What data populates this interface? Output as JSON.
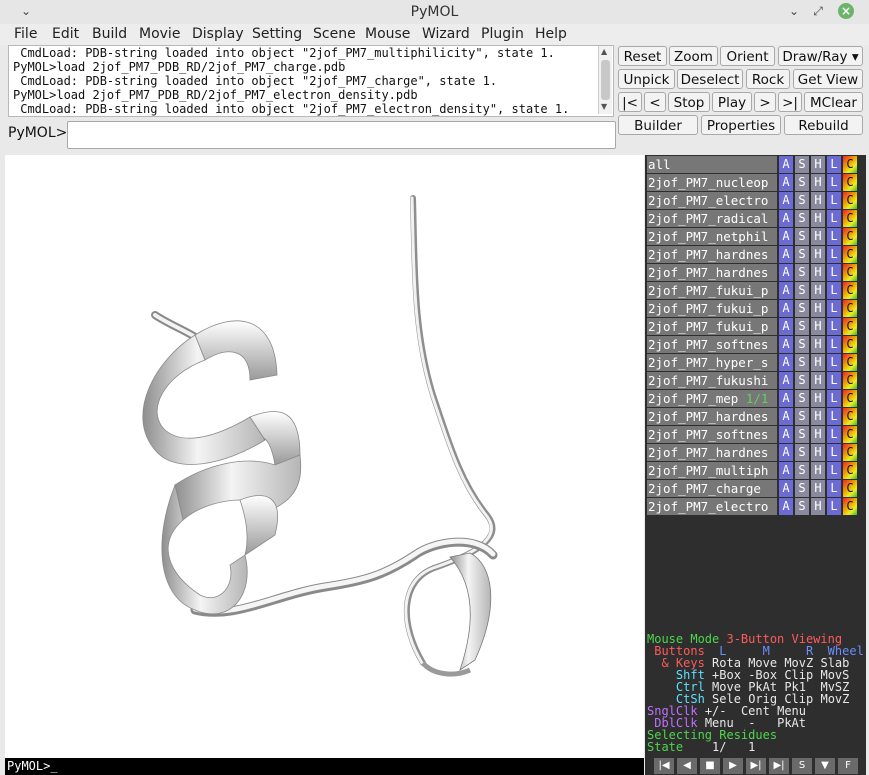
{
  "window": {
    "title": "PyMOL"
  },
  "menu": [
    "File",
    "Edit",
    "Build",
    "Movie",
    "Display",
    "Setting",
    "Scene",
    "Mouse",
    "Wizard",
    "Plugin",
    "Help"
  ],
  "log_lines": [
    " CmdLoad: PDB-string loaded into object \"2jof_PM7_multiphilicity\", state 1.",
    "PyMOL>load 2jof_PM7_PDB_RD/2jof_PM7_charge.pdb",
    " CmdLoad: PDB-string loaded into object \"2jof_PM7_charge\", state 1.",
    "PyMOL>load 2jof_PM7_PDB_RD/2jof_PM7_electron_density.pdb",
    " CmdLoad: PDB-string loaded into object \"2jof_PM7_electron_density\", state 1."
  ],
  "command": {
    "label": "PyMOL>",
    "value": ""
  },
  "buttons": {
    "row1": [
      "Reset",
      "Zoom",
      "Orient",
      "Draw/Ray ▾"
    ],
    "row2": [
      "Unpick",
      "Deselect",
      "Rock",
      "Get View"
    ],
    "row3": [
      "|<",
      "<",
      "Stop",
      "Play",
      ">",
      ">|",
      "MClear"
    ],
    "row4": [
      "Builder",
      "Properties",
      "Rebuild"
    ]
  },
  "objects": [
    {
      "name": "all",
      "state": ""
    },
    {
      "name": "2jof_PM7_nucleop",
      "state": ""
    },
    {
      "name": "2jof_PM7_electro",
      "state": ""
    },
    {
      "name": "2jof_PM7_radical",
      "state": ""
    },
    {
      "name": "2jof_PM7_netphil",
      "state": ""
    },
    {
      "name": "2jof_PM7_hardnes",
      "state": ""
    },
    {
      "name": "2jof_PM7_hardnes",
      "state": ""
    },
    {
      "name": "2jof_PM7_fukui_p",
      "state": ""
    },
    {
      "name": "2jof_PM7_fukui_p",
      "state": ""
    },
    {
      "name": "2jof_PM7_fukui_p",
      "state": ""
    },
    {
      "name": "2jof_PM7_softnes",
      "state": ""
    },
    {
      "name": "2jof_PM7_hyper_s",
      "state": ""
    },
    {
      "name": "2jof_PM7_fukushi",
      "state": ""
    },
    {
      "name": "2jof_PM7_mep",
      "state": "1/1"
    },
    {
      "name": "2jof_PM7_hardnes",
      "state": ""
    },
    {
      "name": "2jof_PM7_softnes",
      "state": ""
    },
    {
      "name": "2jof_PM7_hardnes",
      "state": ""
    },
    {
      "name": "2jof_PM7_multiph",
      "state": ""
    },
    {
      "name": "2jof_PM7_charge",
      "state": ""
    },
    {
      "name": "2jof_PM7_electro",
      "state": ""
    }
  ],
  "object_buttons": [
    "A",
    "S",
    "H",
    "L",
    "C"
  ],
  "mouse_help": {
    "mode_label": "Mouse Mode",
    "mode_value": "3-Button Viewing",
    "buttons_label": "Buttons",
    "col_l": "L",
    "col_m": "M",
    "col_r": "R",
    "col_wheel": "Wheel",
    "rows": [
      {
        "key": "& Keys",
        "l": "Rota",
        "m": "Move",
        "r": "MovZ",
        "w": "Slab"
      },
      {
        "key": "Shft",
        "l": "+Box",
        "m": "-Box",
        "r": "Clip",
        "w": "MovS"
      },
      {
        "key": "Ctrl",
        "l": "Move",
        "m": "PkAt",
        "r": "Pk1",
        "w": "MvSZ"
      },
      {
        "key": "CtSh",
        "l": "Sele",
        "m": "Orig",
        "r": "Clip",
        "w": "MovZ"
      },
      {
        "key": "SnglClk",
        "l": "+/-",
        "m": "Cent",
        "r": "Menu",
        "w": ""
      },
      {
        "key": "DblClk",
        "l": "Menu",
        "m": "-",
        "r": "PkAt",
        "w": ""
      }
    ],
    "selecting": "Selecting Residues",
    "state_label": "State",
    "state_value": "1/   1"
  },
  "bottom_prompt": "PyMOL>_",
  "vcr_buttons": [
    "|◀",
    "◀",
    "■",
    "▶",
    "▶|",
    "▶|",
    "S",
    "▼",
    "F"
  ]
}
